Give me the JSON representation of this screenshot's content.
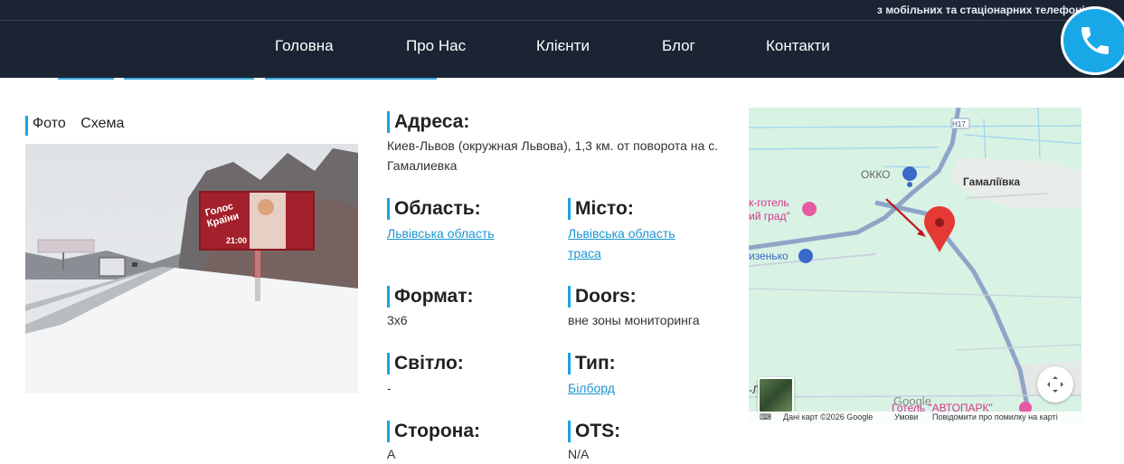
{
  "header": {
    "subtitle": "з мобільних та стаціонарних телефонів",
    "nav": [
      "Головна",
      "Про Нас",
      "Клієнти",
      "Блог",
      "Контакти"
    ]
  },
  "left": {
    "tabs": [
      "Фото",
      "Схема"
    ]
  },
  "fields": {
    "address": {
      "label": "Адреса:",
      "value": "Киев-Львов (окружная Львова), 1,3 км. от поворота на с. Гамалиевка"
    },
    "region": {
      "label": "Область:",
      "value": "Львівська область"
    },
    "city": {
      "label": "Місто:",
      "value_1": "Львівська область",
      "value_2": "траса"
    },
    "format": {
      "label": "Формат:",
      "value": "3x6"
    },
    "doors": {
      "label": "Doors:",
      "value": "вне зоны мониторинга"
    },
    "light": {
      "label": "Світло:",
      "value": "-"
    },
    "type": {
      "label": "Тип:",
      "value": "Білборд"
    },
    "side": {
      "label": "Сторона:",
      "value": "A"
    },
    "ots": {
      "label": "OTS:",
      "value": "N/A"
    }
  },
  "map": {
    "road_badge": "H17",
    "okko": "ОККО",
    "village": "Гамаліївка",
    "hotel_1a": "к-готель",
    "hotel_1b": "ий град\"",
    "shop": "изенько",
    "bottom_left": "-Лянські",
    "hotel_2": "Готель \"АВТОПАРК\"",
    "google": "Google",
    "footer": {
      "data": "Дані карт ©2026 Google",
      "terms": "Умови",
      "report": "Повідомити про помилку на карті"
    },
    "colors": {
      "background": "#d8f2e4",
      "road": "#8fa5c7",
      "pin": "#e53935",
      "arrow": "#c0141a"
    }
  },
  "colors": {
    "header_bg": "#1b2433",
    "accent": "#1ba2e6",
    "link": "#1b95d1",
    "call_button": "#18a8e8"
  }
}
